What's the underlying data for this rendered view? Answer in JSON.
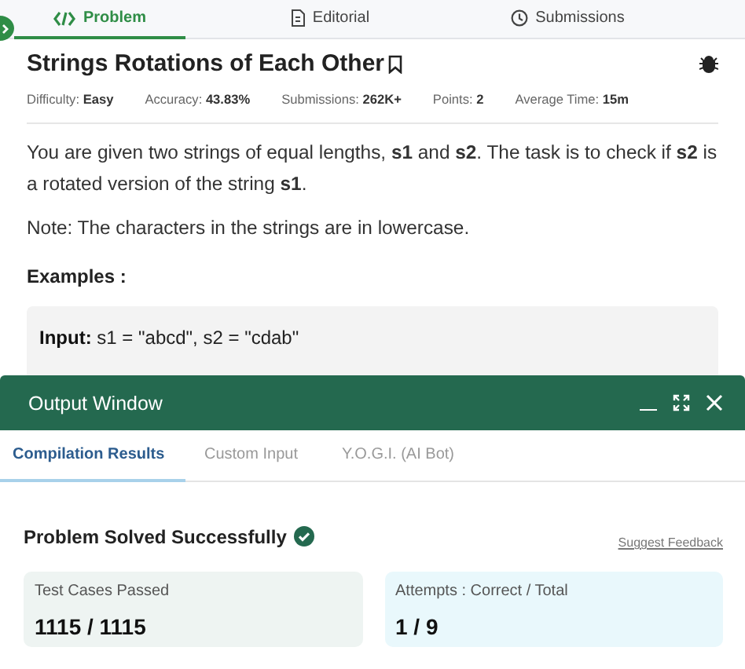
{
  "tabs": [
    {
      "label": "Problem",
      "kind": "code",
      "selected": true
    },
    {
      "label": "Editorial",
      "kind": "document",
      "selected": false
    },
    {
      "label": "Submissions",
      "kind": "clock",
      "selected": false
    }
  ],
  "problem": {
    "title": "Strings Rotations of Each Other",
    "stats": [
      {
        "label": "Difficulty:",
        "value": "Easy"
      },
      {
        "label": "Accuracy:",
        "value": "43.83%"
      },
      {
        "label": "Submissions:",
        "value": "262K+"
      },
      {
        "label": "Points:",
        "value": "2"
      },
      {
        "label": "Average Time:",
        "value": "15m"
      }
    ],
    "description": "You are given two strings of equal lengths, **s1** and **s2**. The task is to check if **s2** is a rotated version of the string **s1**.",
    "note": "Note: The characters in the strings are in lowercase.",
    "examples_heading": "Examples :",
    "example": [
      {
        "label": "Input:",
        "value": "s1 = \"abcd\", s2 = \"cdab\""
      }
    ]
  },
  "output_window": {
    "title": "Output Window",
    "tabs": [
      {
        "label": "Compilation Results",
        "selected": true
      },
      {
        "label": "Custom Input",
        "selected": false
      },
      {
        "label": "Y.O.G.I. (AI Bot)",
        "selected": false
      }
    ],
    "heading": "Problem Solved Successfully",
    "link": "Suggest Feedback",
    "cards": [
      {
        "label": "Test Cases Passed",
        "value": "1115 / 1115",
        "color": "#eef4f2"
      },
      {
        "label": "Attempts : Correct / Total",
        "value": "1 / 9",
        "color": "#e9f8fc"
      }
    ]
  }
}
